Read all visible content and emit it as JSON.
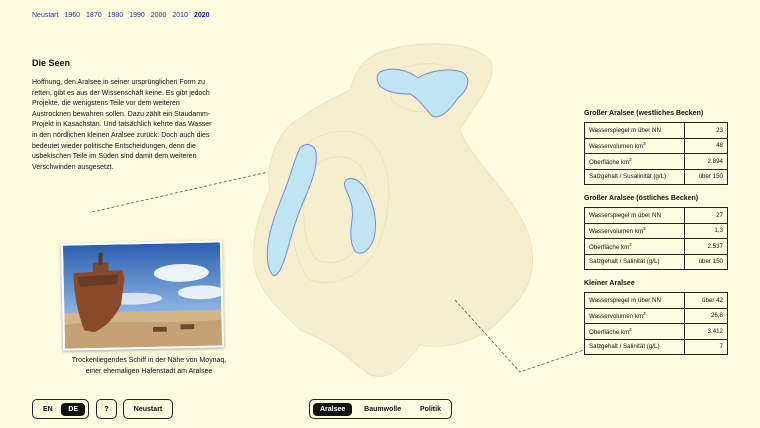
{
  "years": [
    "Neustart",
    "1960",
    "1870",
    "1980",
    "1990",
    "2000",
    "2010",
    "2020"
  ],
  "intro": {
    "title": "Die Seen",
    "text": "Hoffnung, den Aralsee in seiner ursprünglichen Form zu retten, gibt es aus der Wissenschaft keine. Es gibt jedoch Projekte, die wenigstens Teile vor dem weiteren Austrocknen bewahren sollen. Dazu zählt ein Staudamm-Projekt in Kasachstan. Und tatsächlich kehrte das Wasser in den nördlichen kleinen Aralsee zurück. Doch auch dies bedeutet wieder politische Entscheidungen, denn die usbekischen Teile im Süden sind damit dem weiteren Verschwinden ausgesetzt."
  },
  "photo": {
    "caption": "Trockenliegendes Schiff in der Nähe von Moynaq, einer ehemaligen Hafenstadt am Aralsee"
  },
  "tables": [
    {
      "title": "Großer Aralsee (westliches Becken)",
      "rows": [
        {
          "label": "Wasserspiegel m über NN",
          "value": "23"
        },
        {
          "label": "Wasservolumen km",
          "unit": "3",
          "value": "48"
        },
        {
          "label": "Oberfläche km",
          "unit": "2",
          "value": "2.894"
        },
        {
          "label": "Salzgehalt / Susalinität (g/L)",
          "value": "über 150"
        }
      ]
    },
    {
      "title": "Großer Aralsee (östliches Becken)",
      "rows": [
        {
          "label": "Wasserspiegel m über NN",
          "value": "27"
        },
        {
          "label": "Wasservolumen km",
          "unit": "3",
          "value": "1,3"
        },
        {
          "label": "Oberfläche km",
          "unit": "2",
          "value": "2.537"
        },
        {
          "label": "Salzgehalt / Salinität (g/L)",
          "value": "über 150"
        }
      ]
    },
    {
      "title": "Kleiner Aralsee",
      "rows": [
        {
          "label": "Wasserspiegel m über NN",
          "value": "über 42"
        },
        {
          "label": "Wasservolumen km",
          "unit": "3",
          "value": "26,8"
        },
        {
          "label": "Oberfläche km",
          "unit": "2",
          "value": "3.412"
        },
        {
          "label": "Salzgehalt / Salinität (g/L)",
          "value": "7"
        }
      ]
    }
  ],
  "controls": {
    "lang_en": "EN",
    "lang_de": "DE",
    "help": "?",
    "restart": "Neustart",
    "tabs": [
      "Aralsee",
      "Baumwolle",
      "Politik"
    ]
  },
  "colors": {
    "background": "#fdfbe0",
    "water": "#bfe6f2",
    "water_outline": "#7d86d8",
    "basin": "#f6efcf"
  }
}
